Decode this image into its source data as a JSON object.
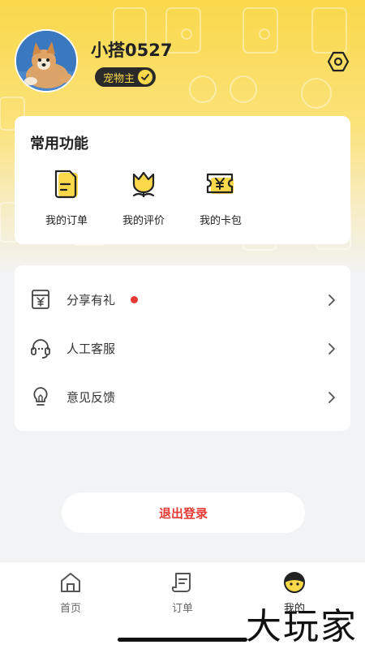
{
  "profile": {
    "username": "小搭0527",
    "role": "宠物主"
  },
  "common_functions": {
    "title": "常用功能",
    "items": [
      {
        "label": "我的订单",
        "icon": "order-doc-icon"
      },
      {
        "label": "我的评价",
        "icon": "tulip-review-icon"
      },
      {
        "label": "我的卡包",
        "icon": "coupon-ticket-icon"
      }
    ]
  },
  "menu": {
    "items": [
      {
        "label": "分享有礼",
        "icon": "gift-box-icon",
        "badge": true
      },
      {
        "label": "人工客服",
        "icon": "headset-icon",
        "badge": false
      },
      {
        "label": "意见反馈",
        "icon": "lightbulb-icon",
        "badge": false
      }
    ]
  },
  "logout": {
    "label": "退出登录"
  },
  "tabbar": {
    "tabs": [
      {
        "label": "首页",
        "icon": "home-icon",
        "active": false
      },
      {
        "label": "订单",
        "icon": "order-tab-icon",
        "active": false
      },
      {
        "label": "我的",
        "icon": "profile-face-icon",
        "active": true
      }
    ]
  },
  "watermark": {
    "text": "大玩家"
  },
  "colors": {
    "accent": "#f9d84a",
    "danger": "#e53935",
    "dark": "#2a2a2a"
  }
}
